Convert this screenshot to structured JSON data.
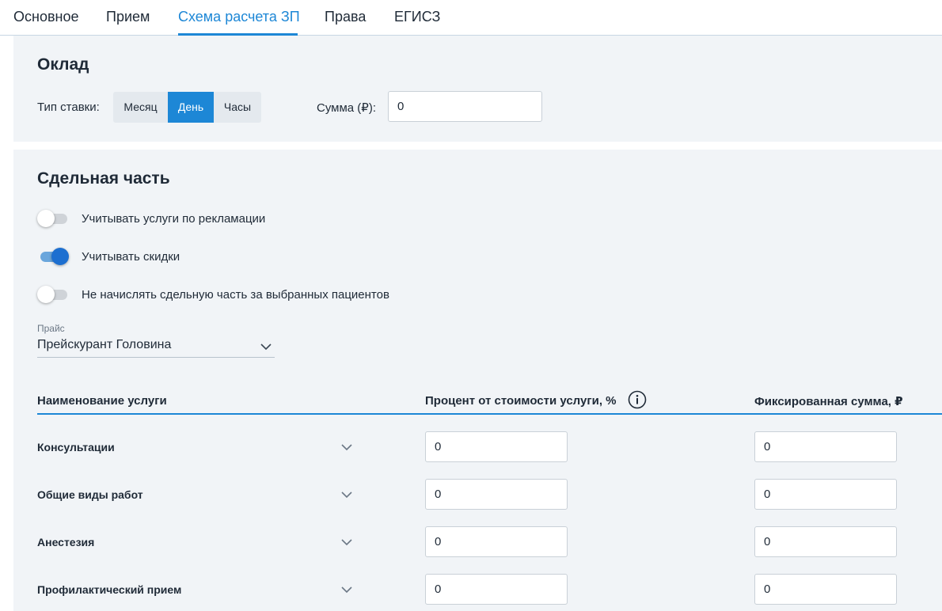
{
  "tabs": [
    {
      "label": "Основное"
    },
    {
      "label": "Прием"
    },
    {
      "label": "Схема расчета ЗП",
      "active": true
    },
    {
      "label": "Права"
    },
    {
      "label": "ЕГИСЗ"
    }
  ],
  "oklad": {
    "title": "Оклад",
    "rate_type_label": "Тип ставки:",
    "rate_options": [
      "Месяц",
      "День",
      "Часы"
    ],
    "rate_selected": "День",
    "sum_label": "Сумма (₽):",
    "sum_value": "0"
  },
  "piecework": {
    "title": "Сдельная часть",
    "toggles": [
      {
        "label": "Учитывать услуги по рекламации",
        "on": false
      },
      {
        "label": "Учитывать скидки",
        "on": true
      },
      {
        "label": "Не начислять сдельную часть за выбранных пациентов",
        "on": false
      }
    ],
    "price_list": {
      "label": "Прайс",
      "value": "Прейскурант Головина",
      "icon": "chevron-down-icon"
    },
    "table": {
      "headers": [
        "Наименование услуги",
        "Процент от стоимости услуги, %",
        "Фиксированная сумма, ₽"
      ],
      "header_icon": "info-icon",
      "rows": [
        {
          "name": "Консультации",
          "percent": "0",
          "fixed": "0"
        },
        {
          "name": "Общие виды работ",
          "percent": "0",
          "fixed": "0"
        },
        {
          "name": "Анестезия",
          "percent": "0",
          "fixed": "0"
        },
        {
          "name": "Профилактический прием",
          "percent": "0",
          "fixed": "0"
        }
      ]
    }
  },
  "colors": {
    "accent": "#1d87d6",
    "panel_bg": "#f1f4f7",
    "toggle_on": "#1d6fd0",
    "text": "#1f2a37"
  }
}
